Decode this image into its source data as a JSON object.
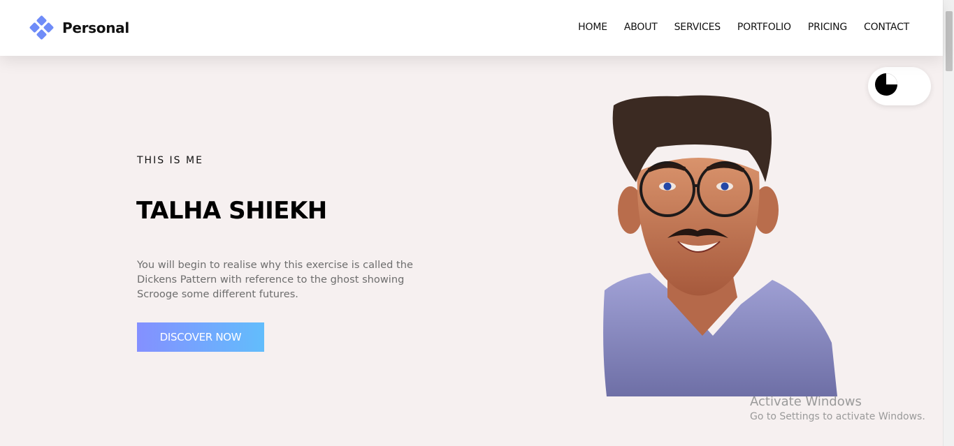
{
  "header": {
    "logo_text": "Personal",
    "nav": [
      "HOME",
      "ABOUT",
      "SERVICES",
      "PORTFOLIO",
      "PRICING",
      "CONTACT"
    ]
  },
  "hero": {
    "tagline": "THIS IS ME",
    "name": "TALHA SHIEKH",
    "description": "You will begin to realise why this exercise is called the Dickens Pattern with reference to the ghost showing Scrooge some different futures.",
    "cta_label": "DISCOVER NOW"
  },
  "theme_toggle": {
    "icon": "moon-icon"
  },
  "watermark": {
    "title": "Activate Windows",
    "subtitle": "Go to Settings to activate Windows."
  },
  "colors": {
    "background": "#f6f0f0",
    "accent_start": "#8490ff",
    "accent_end": "#62bdfc",
    "logo": "#6f8cf8"
  }
}
